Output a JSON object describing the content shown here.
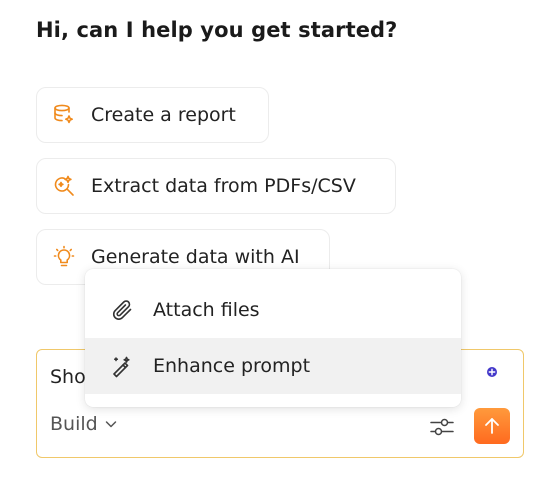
{
  "greeting": "Hi, can I help you get started?",
  "suggestions": [
    {
      "label": "Create a report",
      "icon": "database-sparkle-icon"
    },
    {
      "label": "Extract data from PDFs/CSV",
      "icon": "search-sparkle-icon"
    },
    {
      "label": "Generate data with AI",
      "icon": "lightbulb-head-icon"
    }
  ],
  "composer": {
    "input_value": "Sho",
    "mode_label": "Build"
  },
  "menu": {
    "items": [
      {
        "label": "Attach files",
        "icon": "paperclip-icon"
      },
      {
        "label": "Enhance prompt",
        "icon": "magic-wand-icon"
      }
    ]
  },
  "colors": {
    "accent_orange": "#f08a1c",
    "composer_border": "#f0c86a",
    "send_button": "#ff7a26",
    "plus_badge": "#4338ca"
  }
}
